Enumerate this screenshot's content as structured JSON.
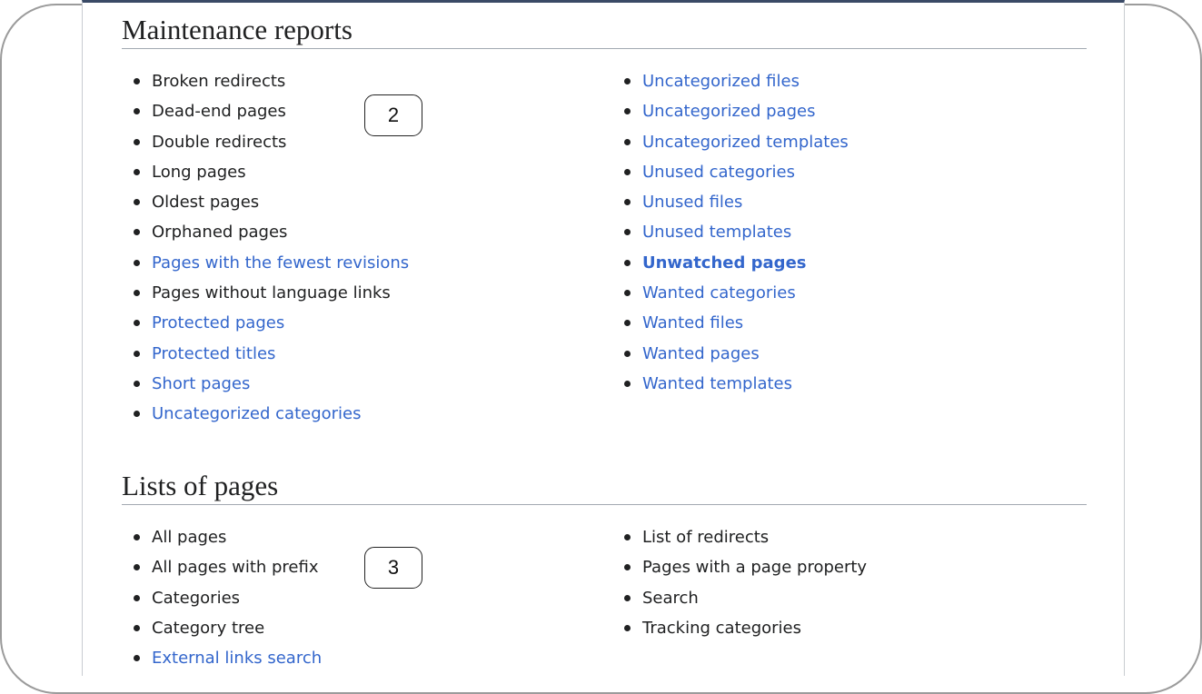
{
  "maintenance": {
    "title": "Maintenance reports",
    "left": [
      {
        "label": "Broken redirects",
        "style": "vis"
      },
      {
        "label": "Dead-end pages",
        "style": "vis"
      },
      {
        "label": "Double redirects",
        "style": "vis"
      },
      {
        "label": "Long pages",
        "style": "vis"
      },
      {
        "label": "Oldest pages",
        "style": "vis"
      },
      {
        "label": "Orphaned pages",
        "style": "vis"
      },
      {
        "label": "Pages with the fewest revisions",
        "style": "lnk"
      },
      {
        "label": "Pages without language links",
        "style": "vis"
      },
      {
        "label": "Protected pages",
        "style": "lnk"
      },
      {
        "label": "Protected titles",
        "style": "lnk"
      },
      {
        "label": "Short pages",
        "style": "lnk"
      },
      {
        "label": "Uncategorized categories",
        "style": "lnk"
      }
    ],
    "right": [
      {
        "label": "Uncategorized files",
        "style": "lnk"
      },
      {
        "label": "Uncategorized pages",
        "style": "lnk"
      },
      {
        "label": "Uncategorized templates",
        "style": "lnk"
      },
      {
        "label": "Unused categories",
        "style": "lnk"
      },
      {
        "label": "Unused files",
        "style": "lnk"
      },
      {
        "label": "Unused templates",
        "style": "lnk"
      },
      {
        "label": "Unwatched pages",
        "style": "bold"
      },
      {
        "label": "Wanted categories",
        "style": "lnk"
      },
      {
        "label": "Wanted files",
        "style": "lnk"
      },
      {
        "label": "Wanted pages",
        "style": "lnk"
      },
      {
        "label": "Wanted templates",
        "style": "lnk"
      }
    ],
    "badge": "2"
  },
  "lists": {
    "title": "Lists of pages",
    "left": [
      {
        "label": "All pages",
        "style": "vis"
      },
      {
        "label": "All pages with prefix",
        "style": "vis"
      },
      {
        "label": "Categories",
        "style": "vis"
      },
      {
        "label": "Category tree",
        "style": "vis"
      },
      {
        "label": "External links search",
        "style": "lnk"
      }
    ],
    "right": [
      {
        "label": "List of redirects",
        "style": "vis"
      },
      {
        "label": "Pages with a page property",
        "style": "vis"
      },
      {
        "label": "Search",
        "style": "vis"
      },
      {
        "label": "Tracking categories",
        "style": "vis"
      }
    ],
    "badge": "3"
  },
  "colors": {
    "link": "#3366cc",
    "visited": "#202122",
    "rule": "#a2a9b1"
  }
}
